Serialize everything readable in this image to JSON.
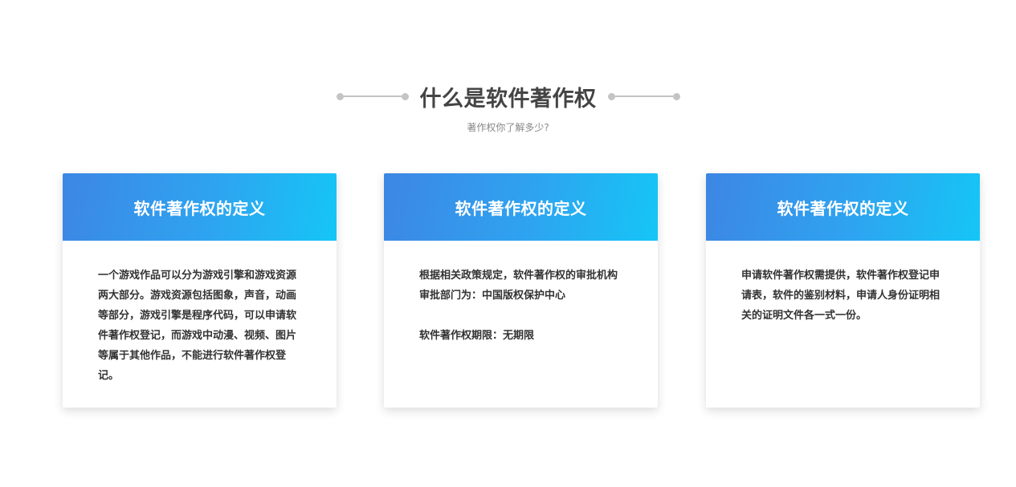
{
  "section": {
    "title": "什么是软件著作权",
    "subtitle": "著作权你了解多少?"
  },
  "cards": [
    {
      "title": "软件著作权的定义",
      "paragraphs": [
        "一个游戏作品可以分为游戏引擎和游戏资源两大部分。游戏资源包括图象，声音，动画等部分，游戏引擎是程序代码，可以申请软件著作权登记，而游戏中动漫、视频、图片等属于其他作品，不能进行软件著作权登记。"
      ]
    },
    {
      "title": "软件著作权的定义",
      "paragraphs": [
        "根据相关政策规定，软件著作权的审批机构审批部门为：中国版权保护中心",
        "软件著作权期限：无期限"
      ]
    },
    {
      "title": "软件著作权的定义",
      "paragraphs": [
        "申请软件著作权需提供，软件著作权登记申请表，软件的鉴别材料，申请人身份证明相关的证明文件各一式一份。"
      ]
    }
  ],
  "colors": {
    "header_gradient_start": "#3d86e4",
    "header_gradient_end": "#15c6f6",
    "title_text": "#444444",
    "subtitle_text": "#888888",
    "decoration": "#c4c4c4"
  }
}
